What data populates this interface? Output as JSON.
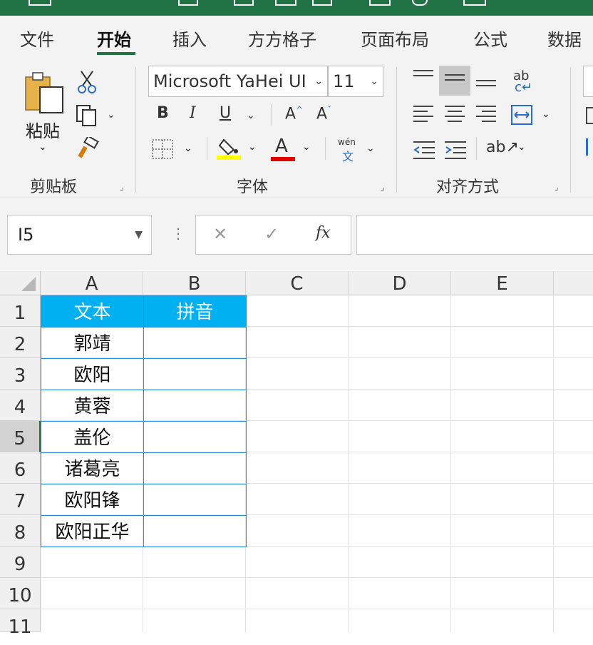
{
  "ribbon_tabs": [
    {
      "label": "文件"
    },
    {
      "label": "开始"
    },
    {
      "label": "插入"
    },
    {
      "label": "方方格子"
    },
    {
      "label": "页面布局"
    },
    {
      "label": "公式"
    },
    {
      "label": "数据"
    }
  ],
  "active_tab": "开始",
  "clipboard": {
    "paste_label": "粘贴",
    "group_label": "剪贴板"
  },
  "font": {
    "font_name": "Microsoft YaHei UI",
    "font_size": "11",
    "bold": "B",
    "italic": "I",
    "underline": "U",
    "grow": "A",
    "shrink": "A",
    "font_color": "A",
    "phonetic_top": "wén",
    "phonetic_bottom": "文",
    "group_label": "字体"
  },
  "alignment": {
    "wrap_text": "ab",
    "group_label": "对齐方式"
  },
  "formula_bar": {
    "name_box": "I5",
    "cancel": "✕",
    "enter": "✓",
    "fx": "fx",
    "formula": ""
  },
  "columns": [
    "A",
    "B",
    "C",
    "D",
    "E"
  ],
  "rows": [
    "1",
    "2",
    "3",
    "4",
    "5",
    "6",
    "7",
    "8",
    "9",
    "10",
    "11"
  ],
  "table": {
    "header": [
      "文本",
      "拼音"
    ],
    "rows": [
      [
        "郭靖",
        ""
      ],
      [
        "欧阳",
        ""
      ],
      [
        "黄蓉",
        ""
      ],
      [
        "盖伦",
        ""
      ],
      [
        "诸葛亮",
        ""
      ],
      [
        "欧阳锋",
        ""
      ],
      [
        "欧阳正华",
        ""
      ]
    ]
  },
  "colors": {
    "excel_green": "#217346",
    "header_fill": "#00b0f0",
    "highlight_yellow": "#ffff00",
    "font_red": "#e00000",
    "table_border": "#2e8fd1"
  }
}
